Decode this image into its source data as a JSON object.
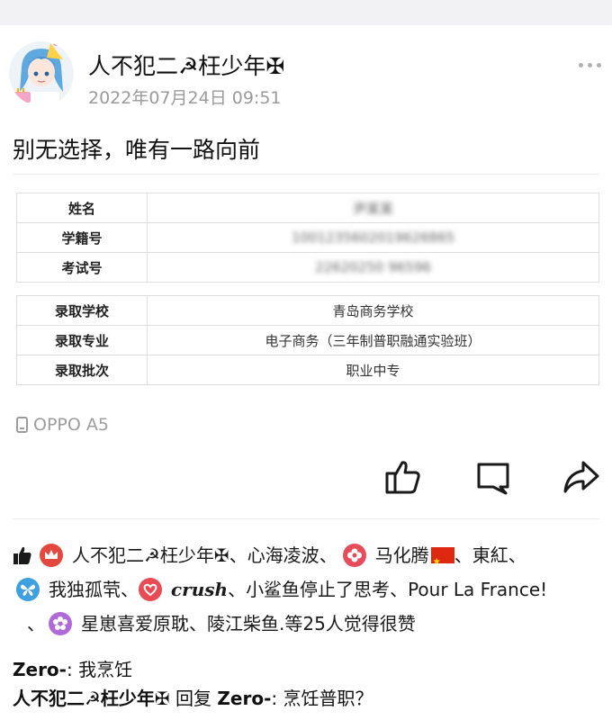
{
  "post": {
    "author": "人不犯二☭枉少年✠",
    "timestamp": "2022年07月24日 09:51",
    "text": "别无选择，唯有一路向前",
    "device": "OPPO A5"
  },
  "admission_table": {
    "rows_top": [
      {
        "label": "姓名",
        "value": "尹某某"
      },
      {
        "label": "学籍号",
        "value": "1001235602019626865"
      },
      {
        "label": "考试号",
        "value": "22620250 96596"
      }
    ],
    "rows_bottom": [
      {
        "label": "录取学校",
        "value": "青岛商务学校"
      },
      {
        "label": "录取专业",
        "value": "电子商务（三年制普职融通实验班）"
      },
      {
        "label": "录取批次",
        "value": "职业中专"
      }
    ]
  },
  "likes": {
    "names": [
      "人不犯二☭枉少年✠",
      "心海凌波",
      "马化腾",
      "東紅",
      "我独孤茕",
      "crush",
      "小鲨鱼停止了思考",
      "Pour La France!",
      "星崽喜爱原耽",
      "陵江柴鱼."
    ],
    "separator": "、",
    "summary": "等25人觉得很赞"
  },
  "comments": [
    {
      "author": "Zero-",
      "text": ": 我烹饪"
    },
    {
      "author": "人不犯二☭枉少年✠",
      "reply_word": " 回复 ",
      "reply_to": "Zero-",
      "text": ": 烹饪普职？"
    }
  ],
  "icons": {
    "more": "more-dots-icon",
    "like": "thumbs-up-icon",
    "comment": "comment-bubble-icon",
    "share": "share-arrow-icon",
    "device": "phone-icon"
  },
  "colors": {
    "accent_red": "#e2483d",
    "flower_pink": "#e64c5c",
    "butterfly_blue": "#3fa0e0",
    "heart_red": "#e94b55",
    "flower_purple": "#b06ad8",
    "meta_gray": "#9a9a9a"
  }
}
